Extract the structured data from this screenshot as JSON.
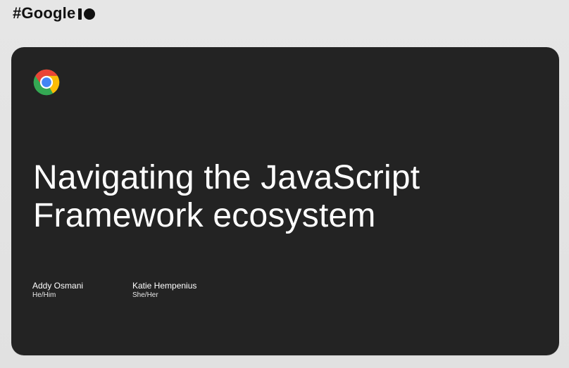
{
  "brand": {
    "text": "#Google",
    "icon": "google-io-mark-icon"
  },
  "slide": {
    "logo_icon": "chrome-icon",
    "title_line1": "Navigating the JavaScript",
    "title_line2": "Framework ecosystem",
    "speakers": [
      {
        "name": "Addy Osmani",
        "pronouns": "He/Him"
      },
      {
        "name": "Katie Hempenius",
        "pronouns": "She/Her"
      }
    ]
  },
  "colors": {
    "background": "#e3e3e3",
    "slide_background": "#232323",
    "title_text": "#ffffff",
    "brand_text": "#111111"
  }
}
